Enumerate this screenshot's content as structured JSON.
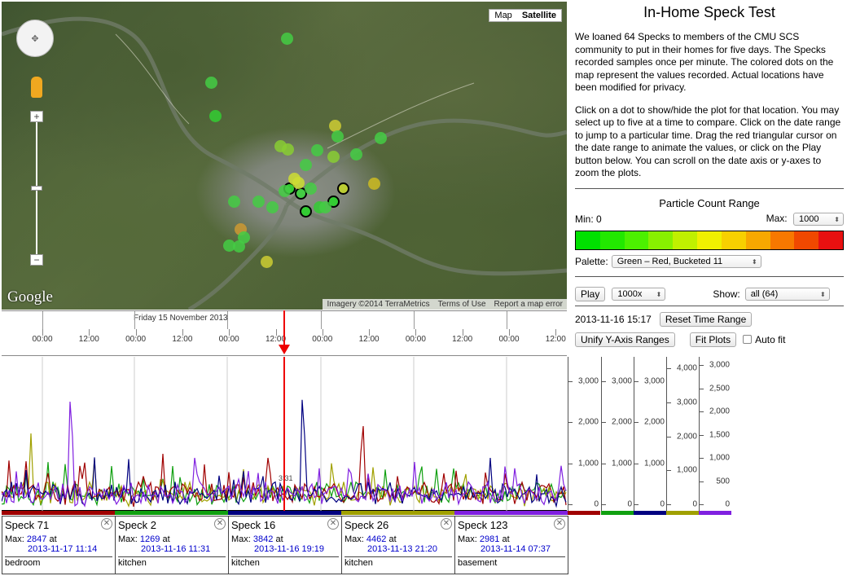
{
  "map": {
    "type_map": "Map",
    "type_sat": "Satellite",
    "logo": "Google",
    "attribution": [
      "Imagery ©2014 TerraMetrics",
      "Terms of Use",
      "Report a map error"
    ],
    "zoom_in": "+",
    "zoom_out": "−"
  },
  "panel": {
    "title": "In-Home Speck Test",
    "intro": "We loaned 64 Specks to members of the CMU SCS community to put in their homes for five days. The Specks recorded samples once per minute. The colored dots on the map represent the values recorded. Actual locations have been modified for privacy.",
    "instructions": "Click on a dot to show/hide the plot for that location. You may select up to five at a time to compare. Click on the date range to jump to a particular time. Drag the red triangular cursor on the date range to animate the values, or click on the Play button below. You can scroll on the date axis or y-axes to zoom the plots.",
    "range_title": "Particle Count Range",
    "min_label": "Min: 0",
    "max_label": "Max:",
    "max_value": "1000",
    "colors": [
      "#00e000",
      "#22e800",
      "#4cf000",
      "#88f000",
      "#c0f000",
      "#f0f000",
      "#f8d000",
      "#f8a800",
      "#f87800",
      "#f04800",
      "#e81010"
    ],
    "palette_label": "Palette:",
    "palette_value": "Green – Red, Bucketed 11",
    "play": "Play",
    "speed": "1000x",
    "show_label": "Show:",
    "show_value": "all (64)",
    "current_time": "2013-11-16 15:17",
    "reset": "Reset Time Range",
    "unify": "Unify Y-Axis Ranges",
    "fit": "Fit Plots",
    "autofit": "Auto fit"
  },
  "timeline": {
    "date": "Friday 15 November 2013",
    "ticks": [
      "00:00",
      "12:00",
      "00:00",
      "12:00",
      "00:00",
      "12:00",
      "00:00",
      "12:00",
      "00:00",
      "12:00",
      "00:00",
      "12:00",
      "00:00",
      "12:00"
    ],
    "marker": "3:31"
  },
  "yaxes": [
    {
      "labels": [
        "3,000",
        "2,000",
        "1,000",
        "0"
      ],
      "color": "#a00000"
    },
    {
      "labels": [
        "3,000",
        "2,000",
        "1,000",
        "0"
      ],
      "color": "#10a010"
    },
    {
      "labels": [
        "3,000",
        "2,000",
        "1,000",
        "0"
      ],
      "color": "#000080"
    },
    {
      "labels": [
        "4,000",
        "3,000",
        "2,000",
        "1,000",
        "0"
      ],
      "color": "#a0a000"
    },
    {
      "labels": [
        "3,000",
        "2,500",
        "2,000",
        "1,500",
        "1,000",
        "500",
        "0"
      ],
      "color": "#8020e0"
    }
  ],
  "specks": [
    {
      "name": "Speck 71",
      "max_label": "Max:",
      "max": "2847",
      "at": "at",
      "date": "2013-11-17 11:14",
      "loc": "bedroom",
      "color": "#a00000"
    },
    {
      "name": "Speck 2",
      "max_label": "Max:",
      "max": "1269",
      "at": "at",
      "date": "2013-11-16 11:31",
      "loc": "kitchen",
      "color": "#10a010"
    },
    {
      "name": "Speck 16",
      "max_label": "Max:",
      "max": "3842",
      "at": "at",
      "date": "2013-11-16 19:19",
      "loc": "kitchen",
      "color": "#000080"
    },
    {
      "name": "Speck 26",
      "max_label": "Max:",
      "max": "4462",
      "at": "at",
      "date": "2013-11-13 21:20",
      "loc": "kitchen",
      "color": "#a0a000"
    },
    {
      "name": "Speck 123",
      "max_label": "Max:",
      "max": "2981",
      "at": "at",
      "date": "2013-11-14 07:37",
      "loc": "basement",
      "color": "#8020e0"
    }
  ]
}
